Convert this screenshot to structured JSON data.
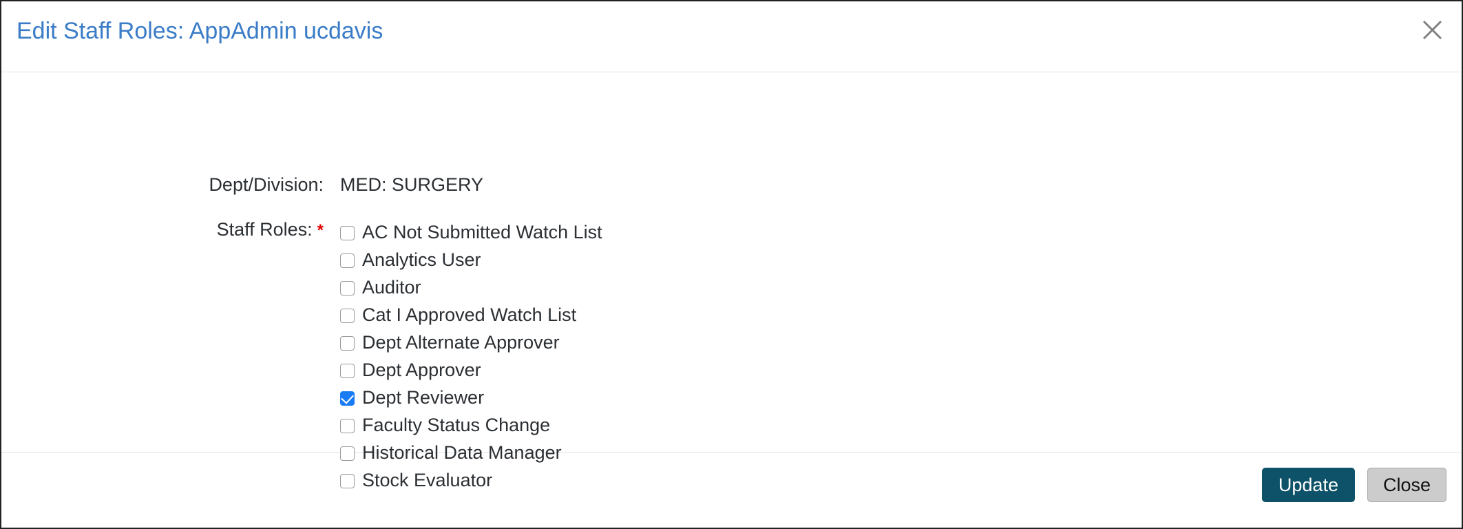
{
  "dialog": {
    "title": "Edit Staff Roles: AppAdmin ucdavis",
    "close_icon": "close-icon",
    "accent_blue": "#3a7cc7",
    "checkbox_blue": "#1a7cf5",
    "update_teal": "#0d5268",
    "close_gray": "#cccccc",
    "required_red": "#e00000"
  },
  "form": {
    "dept_division": {
      "label": "Dept/Division:",
      "value": "MED: SURGERY"
    },
    "staff_roles": {
      "label": "Staff Roles:",
      "required_marker": "*",
      "options": [
        {
          "label": "AC Not Submitted Watch List",
          "checked": false
        },
        {
          "label": "Analytics User",
          "checked": false
        },
        {
          "label": "Auditor",
          "checked": false
        },
        {
          "label": "Cat I Approved Watch List",
          "checked": false
        },
        {
          "label": "Dept Alternate Approver",
          "checked": false
        },
        {
          "label": "Dept Approver",
          "checked": false
        },
        {
          "label": "Dept Reviewer",
          "checked": true
        },
        {
          "label": "Faculty Status Change",
          "checked": false
        },
        {
          "label": "Historical Data Manager",
          "checked": false
        },
        {
          "label": "Stock Evaluator",
          "checked": false
        }
      ]
    }
  },
  "footer": {
    "update_label": "Update",
    "close_label": "Close"
  }
}
